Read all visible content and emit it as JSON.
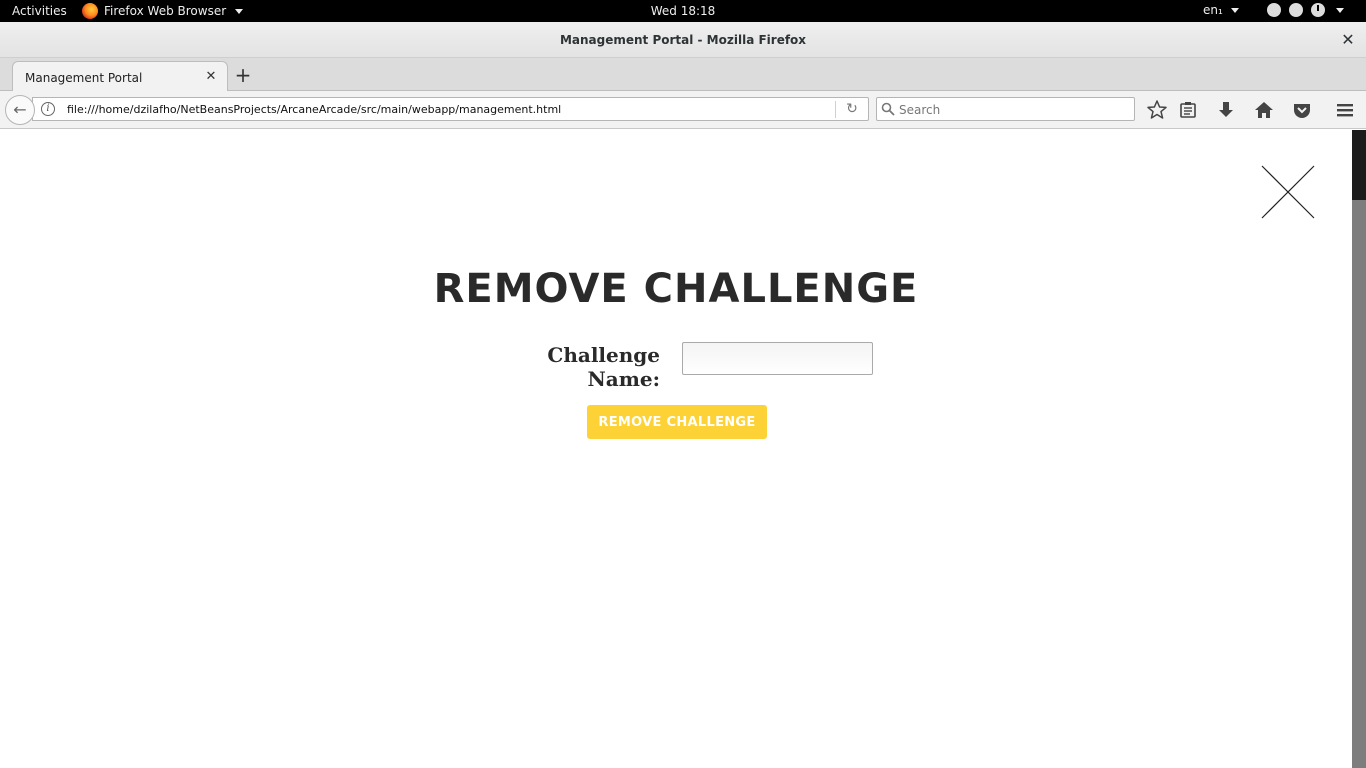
{
  "system_bar": {
    "activities": "Activities",
    "app_name": "Firefox Web Browser",
    "clock": "Wed 18:18",
    "language": "en₁"
  },
  "window": {
    "title": "Management Portal - Mozilla Firefox",
    "close_glyph": "✕"
  },
  "tabs": [
    {
      "label": "Management Portal",
      "close_glyph": "✕"
    }
  ],
  "new_tab_glyph": "+",
  "navbar": {
    "back_glyph": "←",
    "info_glyph": "i",
    "url": "file:///home/dzilafho/NetBeansProjects/ArcaneArcade/src/main/webapp/management.html",
    "reload_glyph": "↻",
    "search_placeholder": "Search",
    "toolbar_icons": [
      "star-icon",
      "reading-list-icon",
      "download-icon",
      "home-icon",
      "pocket-icon",
      "menu-icon"
    ]
  },
  "page": {
    "heading": "REMOVE CHALLENGE",
    "field_label": "Challenge Name:",
    "field_value": "",
    "button_label": "REMOVE CHALLENGE",
    "button_color": "#fdd237",
    "text_color": "#2a2a2a"
  }
}
